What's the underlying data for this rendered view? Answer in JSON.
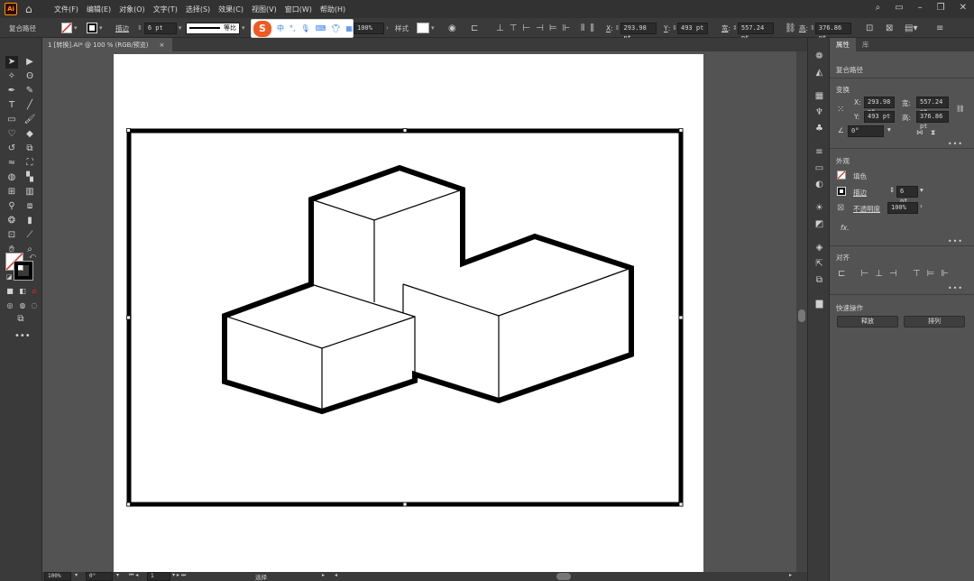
{
  "app": {
    "logo": "Ai",
    "menus": [
      "文件(F)",
      "编辑(E)",
      "对象(O)",
      "文字(T)",
      "选择(S)",
      "效果(C)",
      "视图(V)",
      "窗口(W)",
      "帮助(H)"
    ]
  },
  "controlbar": {
    "selection_label": "复合路径",
    "stroke_label": "描边",
    "stroke_weight": "6 pt",
    "stroke_profile": "等比",
    "opacity_value": "100%",
    "style_label": "样式",
    "x_label": "X",
    "x_value": "293.98 pt",
    "y_label": "Y",
    "y_value": "493 pt",
    "w_label": "宽",
    "w_value": "557.24 pt",
    "h_label": "高",
    "h_value": "376.86 pt"
  },
  "ime": {
    "chinese": "中",
    "punct": "°,"
  },
  "document": {
    "tab_title": "1 [转换].AI* @ 100 % (RGB/预览)",
    "close": "×"
  },
  "status": {
    "zoom": "100%",
    "rotation": "0°",
    "artboard_number": "1",
    "tool_name": "选择"
  },
  "properties": {
    "tab_properties": "属性",
    "tab_library": "库",
    "object_type": "复合路径",
    "transform_title": "变换",
    "x_label": "X:",
    "x_value": "293.98 pt",
    "y_label": "Y:",
    "y_value": "493 pt",
    "w_label": "宽:",
    "w_value": "557.24 pt",
    "h_label": "高:",
    "h_value": "376.86 pt",
    "angle_value": "0°",
    "appearance_title": "外观",
    "fill_label": "填色",
    "stroke_label": "描边",
    "stroke_value": "6 pt",
    "opacity_label": "不透明度",
    "opacity_value": "100%",
    "fx_label": "fx.",
    "align_title": "对齐",
    "quick_actions_title": "快速操作",
    "release_button": "释放",
    "arrange_button": "排列"
  },
  "colors": {
    "app_bg": "#535353",
    "panel_bg": "#3a3a3a",
    "menubar_bg": "#323232",
    "artboard": "#ffffff",
    "stroke": "#000000",
    "fill_none": "#e0251b",
    "ime_brand": "#f05a22"
  }
}
